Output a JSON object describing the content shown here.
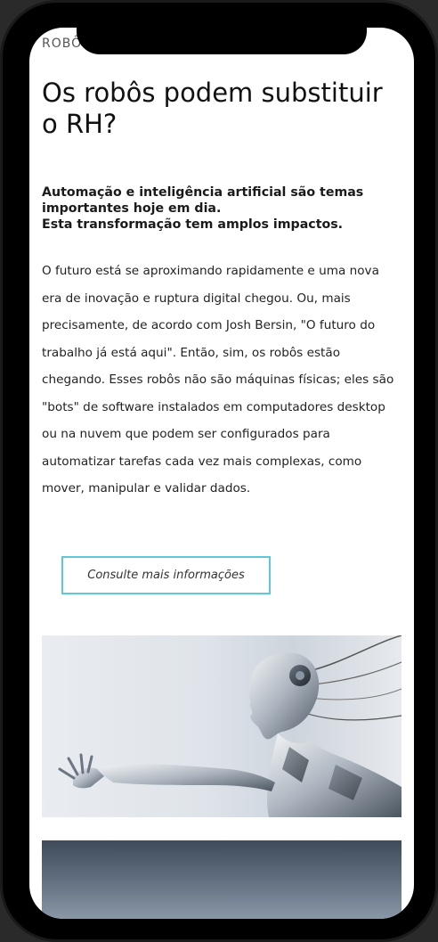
{
  "article": {
    "kicker": "ROBÔ",
    "title": "Os robôs podem substituir o RH?",
    "lead_line1": "Automação e inteligência artificial são temas importantes hoje em dia.",
    "lead_line2": "Esta transformação tem amplos impactos.",
    "body": "O futuro está se aproximando rapidamente e uma nova era de inovação e ruptura digital chegou. Ou, mais precisamente, de acordo com Josh Bersin, \"O futuro do trabalho já está aqui\". Então, sim, os robôs estão chegando. Esses robôs não são máquinas físicas; eles são \"bots\" de software instalados em computadores desktop ou na nuvem que podem ser configurados para automatizar tarefas cada vez mais complexas, como mover, manipular e validar dados.",
    "cta_label": "Consulte mais informações"
  },
  "colors": {
    "cta_border": "#5ec7d8",
    "background": "#ffffff"
  },
  "images": {
    "hero": "robot-humanoid-illustration",
    "secondary": "cloudy-sky-photo"
  }
}
